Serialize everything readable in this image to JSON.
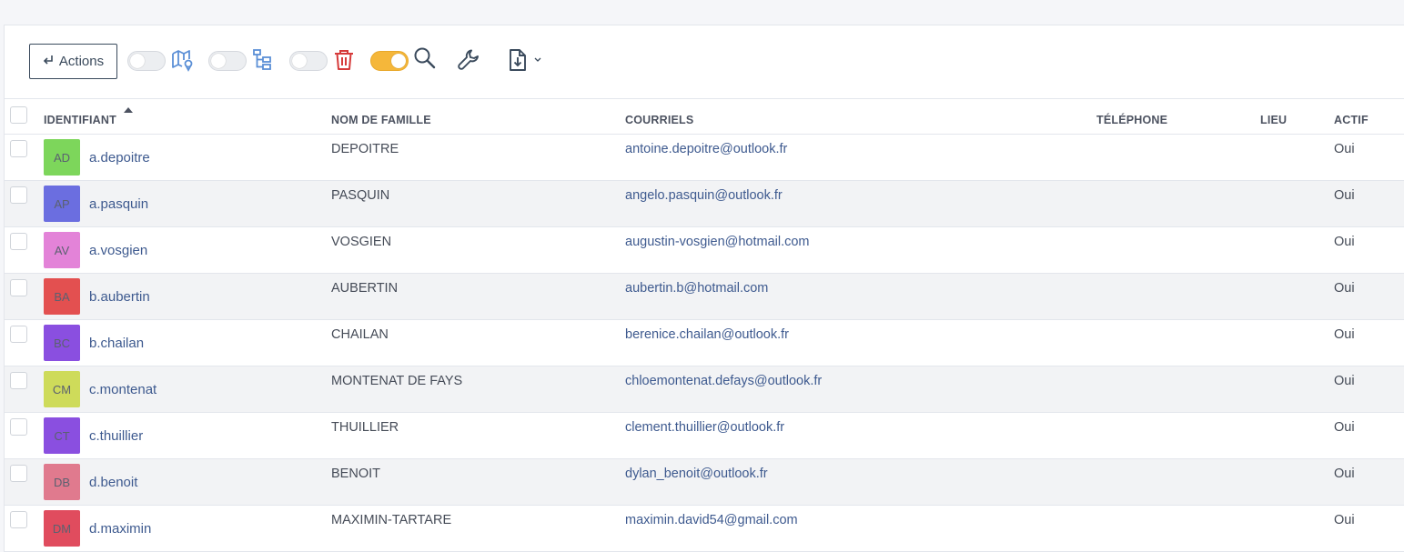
{
  "toolbar": {
    "actions_label": "Actions",
    "actions_icon": "return-arrow-icon",
    "toggles": [
      {
        "name": "map-toggle",
        "on": false,
        "icon": "map-pin-icon",
        "icon_color": "#5b8fd6"
      },
      {
        "name": "hierarchy-toggle",
        "on": false,
        "icon": "hierarchy-icon",
        "icon_color": "#5b8fd6"
      },
      {
        "name": "trash-toggle",
        "on": false,
        "icon": "trash-icon",
        "icon_color": "#d63b3b"
      },
      {
        "name": "search-toggle",
        "on": true,
        "icon": "search-icon",
        "icon_color": "#3a4a5c"
      }
    ],
    "tools": [
      "wrench-icon",
      "export-file-icon",
      "chevron-down-icon"
    ],
    "toggle_on_color": "#f5b73a"
  },
  "columns": {
    "identifiant": "IDENTIFIANT",
    "nom": "NOM DE FAMILLE",
    "courriels": "COURRIELS",
    "telephone": "TÉLÉPHONE",
    "lieu": "LIEU",
    "actif": "ACTIF",
    "sorted_column": "identifiant",
    "sort_direction": "asc"
  },
  "rows": [
    {
      "initials": "AD",
      "color": "#7dd65b",
      "id": "a.depoitre",
      "nom": "DEPOITRE",
      "email": "antoine.depoitre@outlook.fr",
      "tel": "",
      "lieu": "",
      "actif": "Oui"
    },
    {
      "initials": "AP",
      "color": "#6b6ee0",
      "id": "a.pasquin",
      "nom": "PASQUIN",
      "email": "angelo.pasquin@outlook.fr",
      "tel": "",
      "lieu": "",
      "actif": "Oui"
    },
    {
      "initials": "AV",
      "color": "#e383d8",
      "id": "a.vosgien",
      "nom": "VOSGIEN",
      "email": "augustin-vosgien@hotmail.com",
      "tel": "",
      "lieu": "",
      "actif": "Oui"
    },
    {
      "initials": "BA",
      "color": "#e35050",
      "id": "b.aubertin",
      "nom": "AUBERTIN",
      "email": "aubertin.b@hotmail.com",
      "tel": "",
      "lieu": "",
      "actif": "Oui"
    },
    {
      "initials": "BC",
      "color": "#8a4fe0",
      "id": "b.chailan",
      "nom": "CHAILAN",
      "email": "berenice.chailan@outlook.fr",
      "tel": "",
      "lieu": "",
      "actif": "Oui"
    },
    {
      "initials": "CM",
      "color": "#cedb5a",
      "id": "c.montenat",
      "nom": "MONTENAT DE FAYS",
      "email": "chloemontenat.defays@outlook.fr",
      "tel": "",
      "lieu": "",
      "actif": "Oui"
    },
    {
      "initials": "CT",
      "color": "#8a4fe0",
      "id": "c.thuillier",
      "nom": "THUILLIER",
      "email": "clement.thuillier@outlook.fr",
      "tel": "",
      "lieu": "",
      "actif": "Oui"
    },
    {
      "initials": "DB",
      "color": "#e07a8e",
      "id": "d.benoit",
      "nom": "BENOIT",
      "email": "dylan_benoit@outlook.fr",
      "tel": "",
      "lieu": "",
      "actif": "Oui"
    },
    {
      "initials": "DM",
      "color": "#e04c5e",
      "id": "d.maximin",
      "nom": "MAXIMIN-TARTARE",
      "email": "maximin.david54@gmail.com",
      "tel": "",
      "lieu": "",
      "actif": "Oui"
    }
  ]
}
